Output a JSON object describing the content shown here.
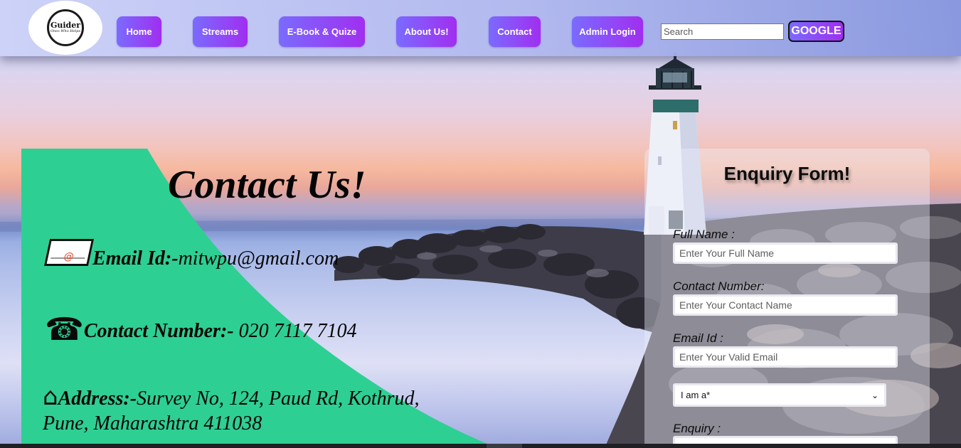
{
  "logo": {
    "title": "Guider",
    "subtitle": "Ones Who Helps"
  },
  "nav": {
    "items": [
      {
        "label": "Home"
      },
      {
        "label": "Streams"
      },
      {
        "label": "E-Book & Quize"
      },
      {
        "label": "About Us!"
      },
      {
        "label": "Contact"
      },
      {
        "label": "Admin Login"
      }
    ],
    "search_placeholder": "Search",
    "search_button": "GOOGLE"
  },
  "contact": {
    "title": "Contact Us!",
    "email_label": "Email Id:-",
    "email_value": "mitwpu@gmail.com",
    "phone_label": "Contact Number:-",
    "phone_value": "020 7117 7104",
    "address_label": "Address:-",
    "address_line1": "Survey No, 124, Paud Rd, Kothrud,",
    "address_line2": "Pune, Maharashtra 411038"
  },
  "enquiry_form": {
    "title": "Enquiry Form!",
    "full_name_label": "Full Name :",
    "full_name_placeholder": "Enter Your Full Name",
    "contact_label": "Contact Number:",
    "contact_placeholder": "Enter Your Contact Name",
    "email_label": "Email Id :",
    "email_placeholder": "Enter Your Valid Email",
    "role_select_value": "I am a*",
    "enquiry_label": "Enquiry :"
  },
  "icons": {
    "email": "mail-envelope-icon",
    "phone": "telephone-icon",
    "address": "house-icon",
    "select_arrow": "chevron-down-icon"
  },
  "colors": {
    "nav_gradient_start": "#7a6bff",
    "nav_gradient_end": "#a12ef0",
    "contact_panel": "#2ecf93"
  }
}
